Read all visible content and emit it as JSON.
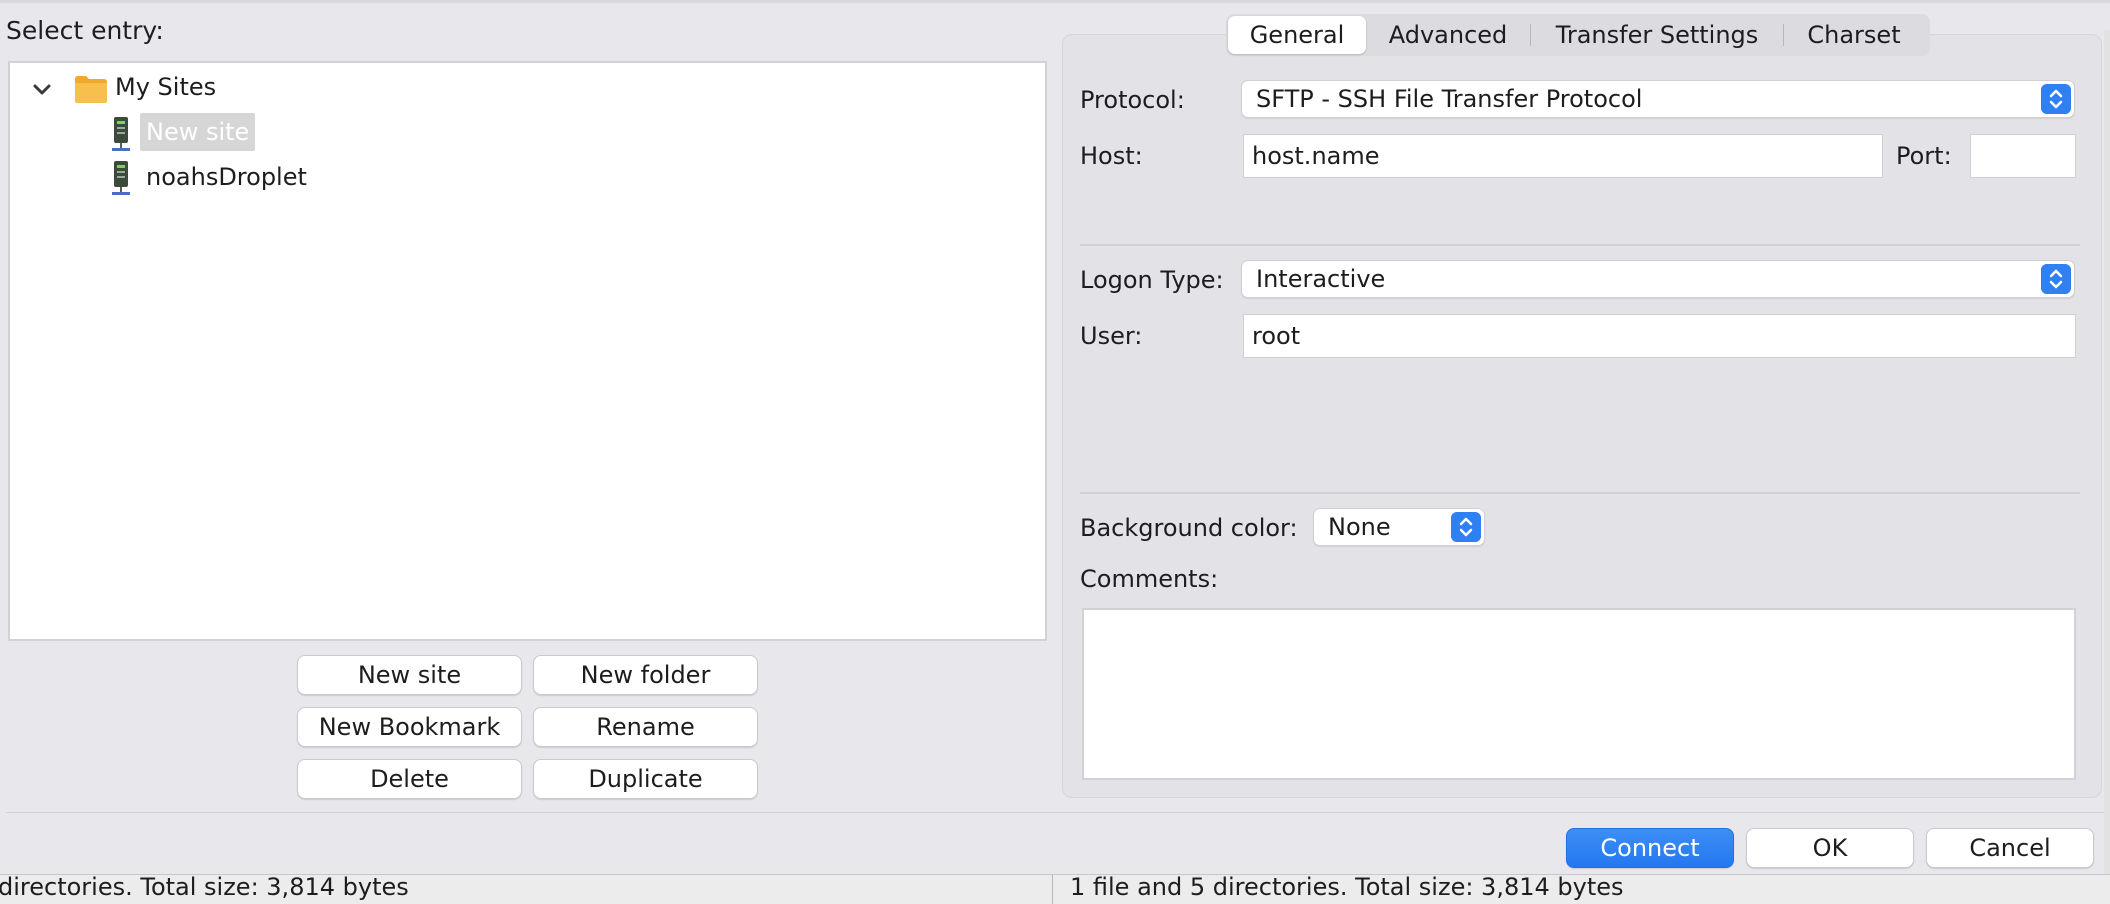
{
  "left_pane": {
    "select_entry_label": "Select entry:",
    "tree": {
      "root_label": "My Sites",
      "items": [
        {
          "label": "New site",
          "selected": true
        },
        {
          "label": "noahsDroplet",
          "selected": false
        }
      ]
    },
    "buttons": {
      "new_site": "New site",
      "new_folder": "New folder",
      "new_bookmark": "New Bookmark",
      "rename": "Rename",
      "delete": "Delete",
      "duplicate": "Duplicate"
    }
  },
  "tabs": [
    "General",
    "Advanced",
    "Transfer Settings",
    "Charset"
  ],
  "active_tab": "General",
  "general": {
    "protocol_label": "Protocol:",
    "protocol_value": "SFTP - SSH File Transfer Protocol",
    "host_label": "Host:",
    "host_value": "host.name",
    "port_label": "Port:",
    "port_value": "",
    "logon_type_label": "Logon Type:",
    "logon_type_value": "Interactive",
    "user_label": "User:",
    "user_value": "root",
    "background_color_label": "Background color:",
    "background_color_value": "None",
    "comments_label": "Comments:",
    "comments_value": ""
  },
  "footer": {
    "connect": "Connect",
    "ok": "OK",
    "cancel": "Cancel"
  },
  "status_bar": {
    "left_text": "directories. Total size: 3,814 bytes",
    "right_text": "1 file and 5 directories. Total size: 3,814 bytes"
  },
  "colors": {
    "accent": "#2f80f3",
    "folder": "#f5b73b",
    "selection": "#d6d6d6"
  },
  "icons": {
    "tree_toggle": "chevron-down-icon",
    "folder": "folder-icon",
    "site": "server-icon",
    "select_arrows": "updown-arrows-icon"
  }
}
